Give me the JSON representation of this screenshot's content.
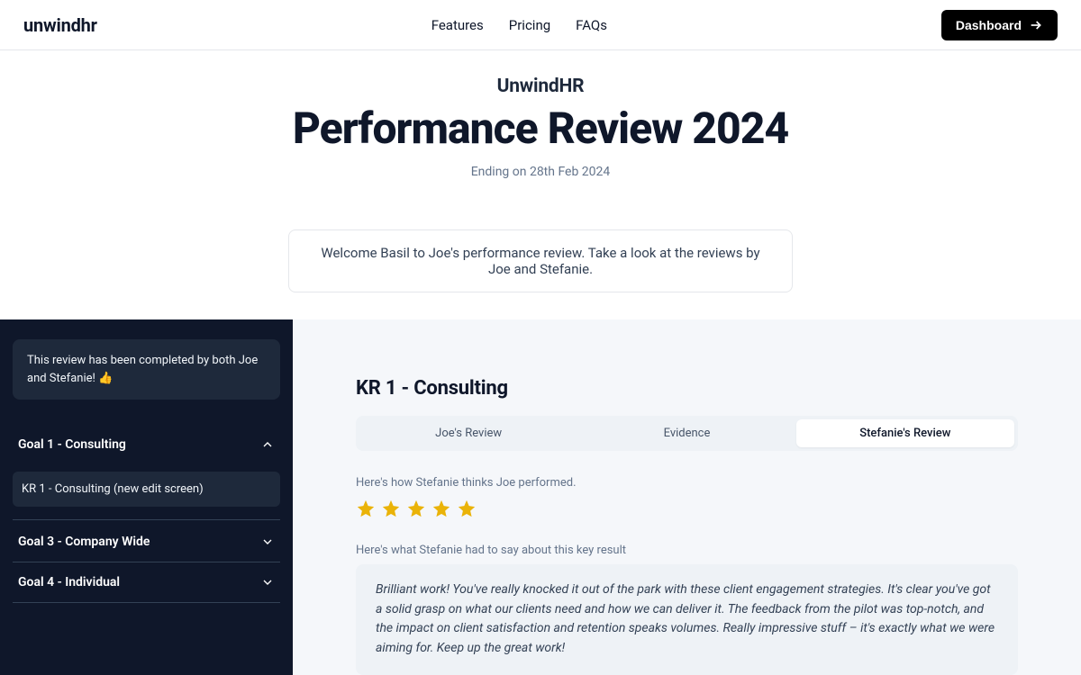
{
  "brand": "unwindhr",
  "nav": {
    "features": "Features",
    "pricing": "Pricing",
    "faqs": "FAQs"
  },
  "dashboard": "Dashboard",
  "hero": {
    "subtitle": "UnwindHR",
    "title": "Performance Review 2024",
    "ending": "Ending on 28th Feb 2024"
  },
  "welcome": "Welcome Basil to Joe's performance review. Take a look at the reviews by Joe and Stefanie.",
  "sidebar": {
    "status": "This review has been completed by both Joe and Stefanie! 👍",
    "goal1": {
      "label": "Goal 1 - Consulting",
      "kr1": "KR 1 - Consulting (new edit screen)"
    },
    "goal3": "Goal 3 - Company Wide",
    "goal4": "Goal 4 - Individual"
  },
  "content": {
    "kr_title": "KR 1 - Consulting",
    "tabs": {
      "joe": "Joe's Review",
      "evidence": "Evidence",
      "stefanie": "Stefanie's Review"
    },
    "perf_label": "Here's how Stefanie thinks Joe performed.",
    "stars": 5,
    "comment_label": "Here's what Stefanie had to say about this key result",
    "comment": "Brilliant work! You've really knocked it out of the park with these client engagement strategies. It's clear you've got a solid grasp on what our clients need and how we can deliver it. The feedback from the pilot was top-notch, and the impact on client satisfaction and retention speaks volumes. Really impressive stuff – it's exactly what we were aiming for. Keep up the great work!"
  }
}
